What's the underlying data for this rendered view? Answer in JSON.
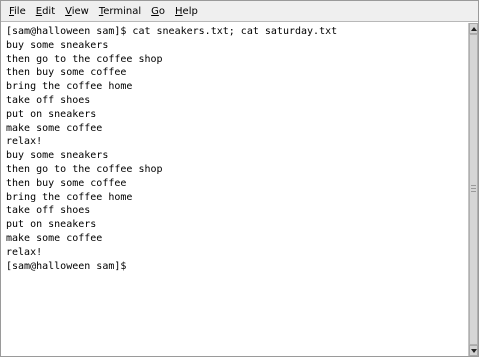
{
  "menu": {
    "items": [
      {
        "accel": "F",
        "rest": "ile"
      },
      {
        "accel": "E",
        "rest": "dit"
      },
      {
        "accel": "V",
        "rest": "iew"
      },
      {
        "accel": "T",
        "rest": "erminal"
      },
      {
        "accel": "G",
        "rest": "o"
      },
      {
        "accel": "H",
        "rest": "elp"
      }
    ]
  },
  "terminal": {
    "lines": [
      "[sam@halloween sam]$ cat sneakers.txt; cat saturday.txt",
      "buy some sneakers",
      "then go to the coffee shop",
      "then buy some coffee",
      "bring the coffee home",
      "take off shoes",
      "put on sneakers",
      "make some coffee",
      "relax!",
      "buy some sneakers",
      "then go to the coffee shop",
      "then buy some coffee",
      "bring the coffee home",
      "take off shoes",
      "put on sneakers",
      "make some coffee",
      "relax!",
      "[sam@halloween sam]$"
    ]
  },
  "scrollbar": {
    "up_icon": "arrow-up-icon",
    "down_icon": "arrow-down-icon"
  }
}
